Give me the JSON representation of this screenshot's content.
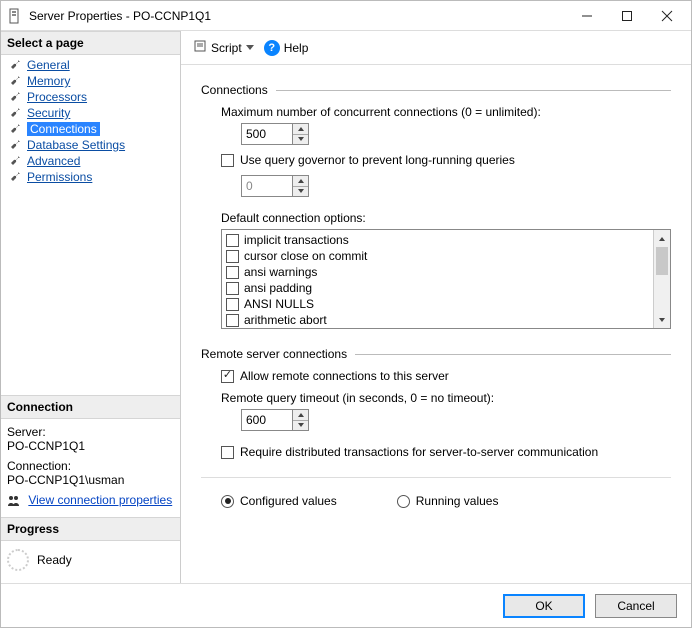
{
  "window": {
    "title": "Server Properties - PO-CCNP1Q1"
  },
  "left": {
    "select_page": "Select a page",
    "pages": [
      {
        "label": "General"
      },
      {
        "label": "Memory"
      },
      {
        "label": "Processors"
      },
      {
        "label": "Security"
      },
      {
        "label": "Connections",
        "selected": true
      },
      {
        "label": "Database Settings"
      },
      {
        "label": "Advanced"
      },
      {
        "label": "Permissions"
      }
    ],
    "connection_head": "Connection",
    "server_lbl": "Server:",
    "server_val": "PO-CCNP1Q1",
    "conn_lbl": "Connection:",
    "conn_val": "PO-CCNP1Q1\\usman",
    "view_props": "View connection properties",
    "progress_head": "Progress",
    "progress_status": "Ready"
  },
  "toolbar": {
    "script": "Script",
    "help": "Help"
  },
  "main": {
    "group_connections": "Connections",
    "max_conn_label": "Maximum number of concurrent connections (0 = unlimited):",
    "max_conn_value": "500",
    "use_governor": {
      "checked": false,
      "label": "Use query governor to prevent long-running queries"
    },
    "governor_value": "0",
    "default_opts_label": "Default connection options:",
    "options": [
      {
        "label": "implicit transactions",
        "checked": false
      },
      {
        "label": "cursor close on commit",
        "checked": false
      },
      {
        "label": "ansi warnings",
        "checked": false
      },
      {
        "label": "ansi padding",
        "checked": false
      },
      {
        "label": "ANSI NULLS",
        "checked": false
      },
      {
        "label": "arithmetic abort",
        "checked": false
      }
    ],
    "group_remote": "Remote server connections",
    "allow_remote": {
      "checked": true,
      "label": "Allow remote connections to this server"
    },
    "remote_timeout_label": "Remote query timeout (in seconds, 0 = no timeout):",
    "remote_timeout_value": "600",
    "require_dist": {
      "checked": false,
      "label": "Require distributed transactions for server-to-server communication"
    },
    "radio_configured": "Configured values",
    "radio_running": "Running values"
  },
  "footer": {
    "ok": "OK",
    "cancel": "Cancel"
  }
}
